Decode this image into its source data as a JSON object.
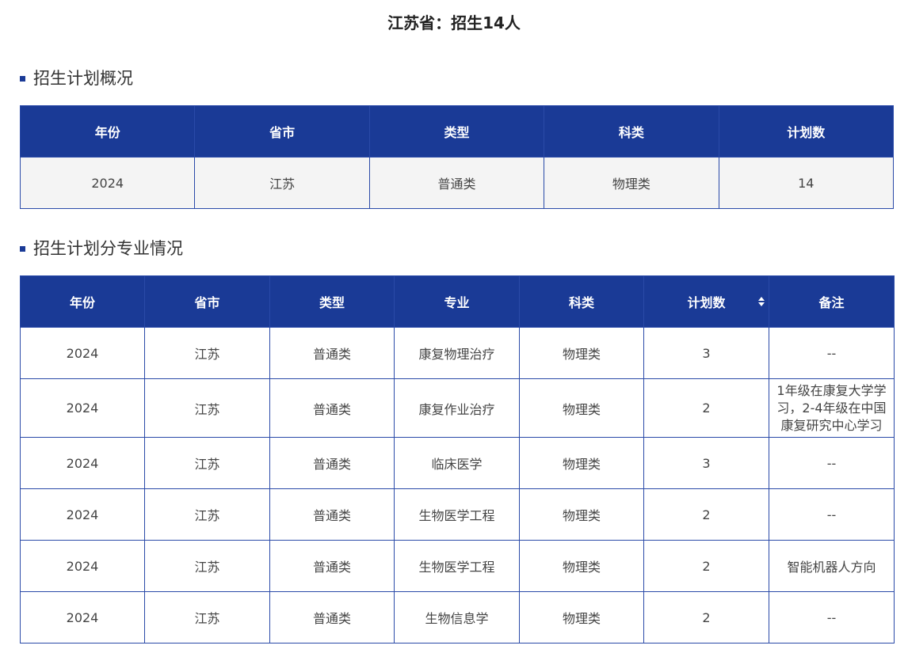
{
  "page_title": "江苏省：招生14人",
  "summary_section": {
    "title": "招生计划概况",
    "headers": [
      "年份",
      "省市",
      "类型",
      "科类",
      "计划数"
    ],
    "rows": [
      [
        "2024",
        "江苏",
        "普通类",
        "物理类",
        "14"
      ]
    ]
  },
  "detail_section": {
    "title": "招生计划分专业情况",
    "headers": [
      "年份",
      "省市",
      "类型",
      "专业",
      "科类",
      "计划数",
      "备注"
    ],
    "sortable_column": "计划数",
    "rows": [
      [
        "2024",
        "江苏",
        "普通类",
        "康复物理治疗",
        "物理类",
        "3",
        "--"
      ],
      [
        "2024",
        "江苏",
        "普通类",
        "康复作业治疗",
        "物理类",
        "2",
        "1年级在康复大学学习，2-4年级在中国康复研究中心学习"
      ],
      [
        "2024",
        "江苏",
        "普通类",
        "临床医学",
        "物理类",
        "3",
        "--"
      ],
      [
        "2024",
        "江苏",
        "普通类",
        "生物医学工程",
        "物理类",
        "2",
        "--"
      ],
      [
        "2024",
        "江苏",
        "普通类",
        "生物医学工程",
        "物理类",
        "2",
        "智能机器人方向"
      ],
      [
        "2024",
        "江苏",
        "普通类",
        "生物信息学",
        "物理类",
        "2",
        "--"
      ]
    ]
  },
  "colors": {
    "header_bg": "#1a3a96",
    "border": "#2a4aa8",
    "summary_row_bg": "#f4f4f4"
  }
}
